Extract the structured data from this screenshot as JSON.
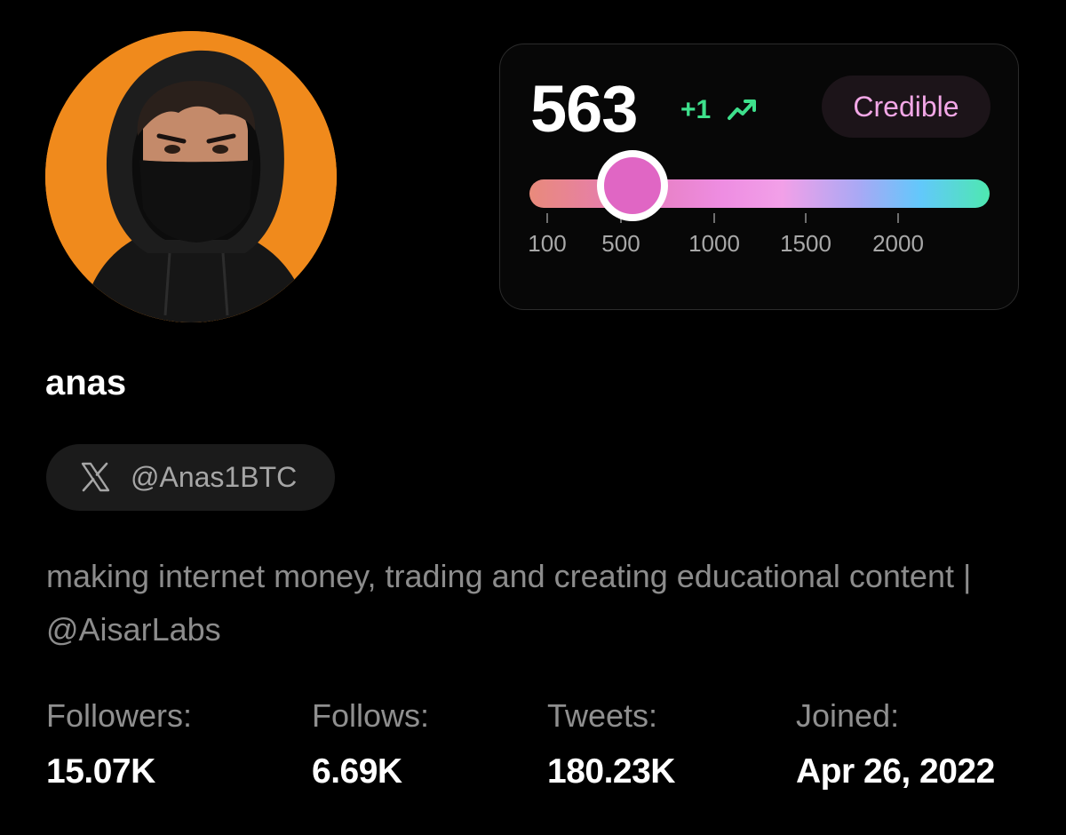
{
  "profile": {
    "display_name": "anas",
    "handle": "@Anas1BTC",
    "bio": "making internet money, trading and creating educational content | @AisarLabs",
    "avatar_icon": "hooded-masked-person-avatar",
    "avatar_background_color": "#f08a1c"
  },
  "score_card": {
    "score": "563",
    "change": "+1",
    "change_color": "#3ee08c",
    "trend_icon": "trending-up-icon",
    "badge_label": "Credible",
    "badge_color": "#f2a7e6",
    "slider": {
      "value": 563,
      "ticks": [
        "100",
        "500",
        "1000",
        "1500",
        "2000"
      ]
    }
  },
  "stats": {
    "followers": {
      "label": "Followers:",
      "value": "15.07K"
    },
    "follows": {
      "label": "Follows:",
      "value": "6.69K"
    },
    "tweets": {
      "label": "Tweets:",
      "value": "180.23K"
    },
    "joined": {
      "label": "Joined:",
      "value": "Apr 26, 2022"
    }
  }
}
